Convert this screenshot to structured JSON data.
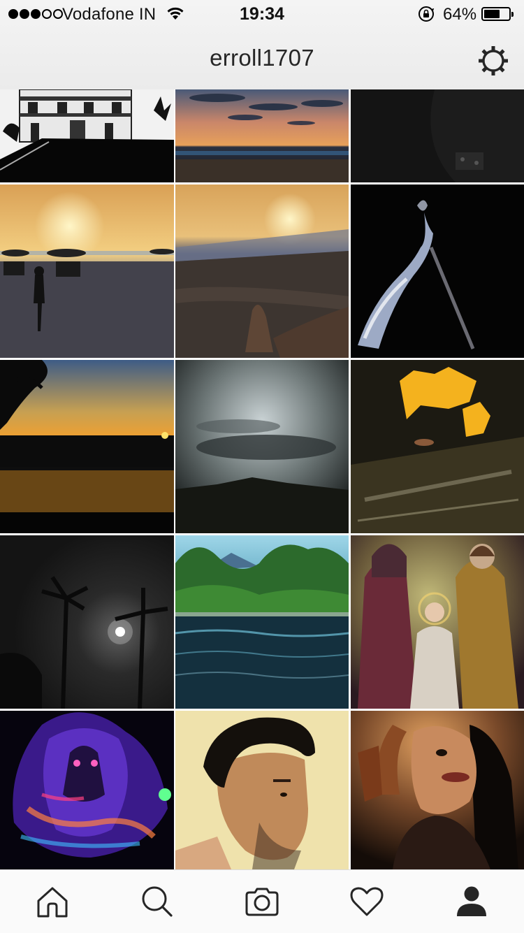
{
  "status_bar": {
    "signal_bars_filled": 3,
    "signal_bars_total": 5,
    "carrier": "Vodafone IN",
    "wifi_icon": "wifi-icon",
    "time": "19:34",
    "rotation_lock_icon": "rotation-lock-icon",
    "battery_percent": "64%",
    "battery_level": 0.64
  },
  "header": {
    "username": "erroll1707",
    "settings_icon": "gear-icon"
  },
  "grid": {
    "columns": 3,
    "photos": [
      {
        "subject": "white church facade silhouette"
      },
      {
        "subject": "orange sunset over sea with clouds"
      },
      {
        "subject": "dark guitar close-up"
      },
      {
        "subject": "beach sunset with umbrellas and woman"
      },
      {
        "subject": "beach sunset with feet in sand"
      },
      {
        "subject": "hand holding incense stick in dark"
      },
      {
        "subject": "golden sunset over river and trees"
      },
      {
        "subject": "dark cloudy sky over hills"
      },
      {
        "subject": "yellow fungus on wet wood"
      },
      {
        "subject": "moon behind palm trees at night"
      },
      {
        "subject": "river with green trees and hills"
      },
      {
        "subject": "painting of holy family"
      },
      {
        "subject": "neon colored ganesha artwork"
      },
      {
        "subject": "portrait of young man in warm light"
      },
      {
        "subject": "woman covering face with hand"
      }
    ]
  },
  "tab_bar": [
    {
      "icon": "home-icon",
      "active": false
    },
    {
      "icon": "search-icon",
      "active": false
    },
    {
      "icon": "camera-icon",
      "active": false
    },
    {
      "icon": "heart-icon",
      "active": false
    },
    {
      "icon": "profile-icon",
      "active": true
    }
  ],
  "colors": {
    "header_bg": "#efefef",
    "grid_bg": "#ffffff",
    "tabbar_bg": "#fafafa",
    "icon": "#262626"
  }
}
